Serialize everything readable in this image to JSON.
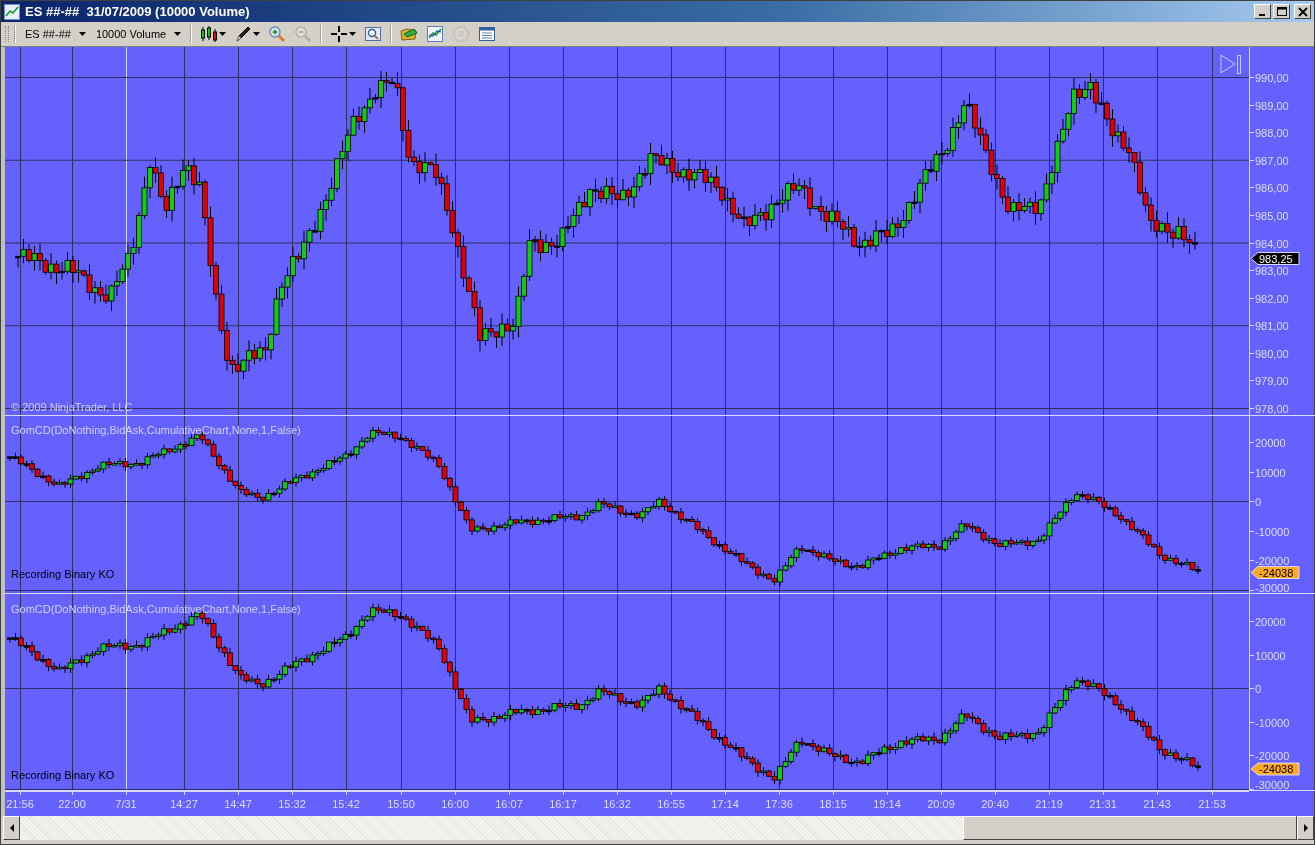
{
  "window": {
    "title": "ES ##-##  31/07/2009 (10000 Volume)"
  },
  "toolbar": {
    "instrument": "ES ##-##",
    "period": "10000 Volume",
    "tool_groups": [
      [
        {
          "kind": "candles",
          "menu": true,
          "disabled": false
        },
        {
          "kind": "pencil",
          "menu": true,
          "disabled": false
        },
        {
          "kind": "zoom-in",
          "menu": false,
          "disabled": false
        },
        {
          "kind": "zoom-out",
          "menu": false,
          "disabled": true
        }
      ],
      [
        {
          "kind": "crosshair",
          "menu": true,
          "disabled": false
        },
        {
          "kind": "magnifier",
          "menu": false,
          "disabled": false
        }
      ],
      [
        {
          "kind": "folder",
          "menu": false,
          "disabled": false
        },
        {
          "kind": "chart",
          "menu": false,
          "disabled": false
        },
        {
          "kind": "coin",
          "menu": false,
          "disabled": true
        },
        {
          "kind": "table",
          "menu": false,
          "disabled": false
        }
      ]
    ]
  },
  "price_panel": {
    "copyright": "© 2009 NinjaTrader, LLC",
    "last_price": "983,25",
    "yticks": [
      "990,00",
      "989,00",
      "988,00",
      "987,00",
      "986,00",
      "985,00",
      "984,00",
      "983,00",
      "982,00",
      "981,00",
      "980,00",
      "979,00",
      "978,00"
    ]
  },
  "indicator_panels": [
    {
      "label": "GomCD(DoNothing,BidAsk,CumulativeChart,None,1,False)",
      "status": "Recording Binary KO",
      "last_value": "-24038",
      "yticks": [
        "20000",
        "10000",
        "0",
        "-10000",
        "-20000",
        "-30000"
      ]
    },
    {
      "label": "GomCD(DoNothing,BidAsk,CumulativeChart,None,1,False)",
      "status": "Recording Binary KO",
      "last_value": "-24038",
      "yticks": [
        "20000",
        "10000",
        "0",
        "-10000",
        "-20000",
        "-30000"
      ]
    }
  ],
  "x_axis": {
    "ticks": [
      {
        "label": "21:56",
        "kind": "time"
      },
      {
        "label": "22:00",
        "kind": "time"
      },
      {
        "label": "7/31",
        "kind": "date"
      },
      {
        "label": "14:27",
        "kind": "time"
      },
      {
        "label": "14:47",
        "kind": "time"
      },
      {
        "label": "15:32",
        "kind": "time"
      },
      {
        "label": "15:42",
        "kind": "time"
      },
      {
        "label": "15:50",
        "kind": "time"
      },
      {
        "label": "16:00",
        "kind": "time"
      },
      {
        "label": "16:07",
        "kind": "time"
      },
      {
        "label": "16:17",
        "kind": "time"
      },
      {
        "label": "16:32",
        "kind": "time"
      },
      {
        "label": "16:55",
        "kind": "time"
      },
      {
        "label": "17:14",
        "kind": "time"
      },
      {
        "label": "17:36",
        "kind": "time"
      },
      {
        "label": "18:15",
        "kind": "time"
      },
      {
        "label": "19:14",
        "kind": "time"
      },
      {
        "label": "20:09",
        "kind": "time"
      },
      {
        "label": "20:40",
        "kind": "time"
      },
      {
        "label": "21:19",
        "kind": "time"
      },
      {
        "label": "21:31",
        "kind": "time"
      },
      {
        "label": "21:43",
        "kind": "time"
      },
      {
        "label": "21:53",
        "kind": "time"
      }
    ]
  }
}
